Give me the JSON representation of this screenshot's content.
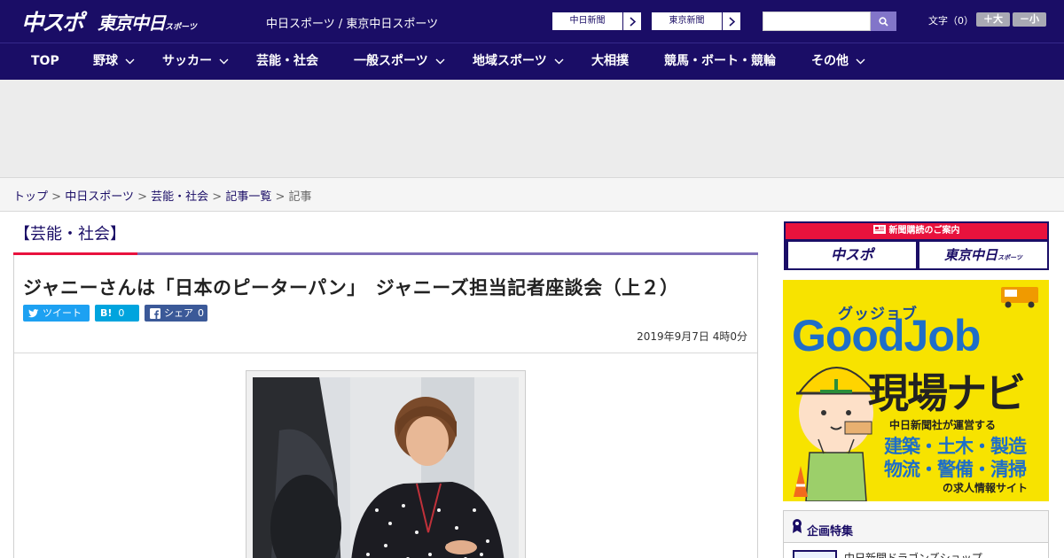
{
  "header": {
    "logo_chuspo": "中スポ",
    "logo_tokyo": "東京中日",
    "logo_tokyo_small": "スポーツ",
    "site_title": "中日スポーツ / 東京中日スポーツ",
    "ext_links": [
      "中日新聞",
      "東京新聞"
    ],
    "search": {
      "placeholder": ""
    },
    "font_size": {
      "label": "文字（0）",
      "larger": "＋大",
      "smaller": "－小"
    }
  },
  "nav": {
    "items": [
      {
        "label": "TOP",
        "dropdown": false
      },
      {
        "label": "野球",
        "dropdown": true
      },
      {
        "label": "サッカー",
        "dropdown": true
      },
      {
        "label": "芸能・社会",
        "dropdown": false
      },
      {
        "label": "一般スポーツ",
        "dropdown": true
      },
      {
        "label": "地域スポーツ",
        "dropdown": true
      },
      {
        "label": "大相撲",
        "dropdown": false
      },
      {
        "label": "競馬・ボート・競輪",
        "dropdown": false
      },
      {
        "label": "その他",
        "dropdown": true
      }
    ]
  },
  "breadcrumb": {
    "items": [
      "トップ",
      "中日スポーツ",
      "芸能・社会",
      "記事一覧"
    ],
    "current": "記事",
    "separator": ">"
  },
  "article": {
    "category": "【芸能・社会】",
    "title": "ジャニーさんは「日本のピーターパン」　ジャニーズ担当記者座談会（上２）",
    "share": {
      "tweet": "ツイート",
      "hatena_icon": "B!",
      "hatena_count": "0",
      "facebook": "シェア",
      "facebook_count": "0"
    },
    "date": "2019年9月7日 4時0分"
  },
  "sidebar": {
    "subscribe": {
      "heading": "新聞購読のご案内",
      "left": "中スポ",
      "right": "東京中日",
      "right_small": "スポーツ"
    },
    "ad": {
      "kana": "グッジョブ",
      "brand": "GoodJob",
      "sub": "現場ナビ",
      "operator": "中日新聞社が運営する",
      "line1": "建築・土木・製造",
      "line2": "物流・警備・清掃",
      "tail": "の求人情報サイト"
    },
    "feature": {
      "title": "企画特集",
      "first_item": "中日新聞ドラゴンズショップ"
    }
  },
  "colors": {
    "brand_navy": "#1a0d66",
    "accent_red": "#e8123d",
    "rule_purple": "#7f6fb8",
    "ad_yellow": "#f7e300",
    "twitter": "#1da1f2",
    "hatena": "#00a4de",
    "facebook": "#3b5998"
  }
}
